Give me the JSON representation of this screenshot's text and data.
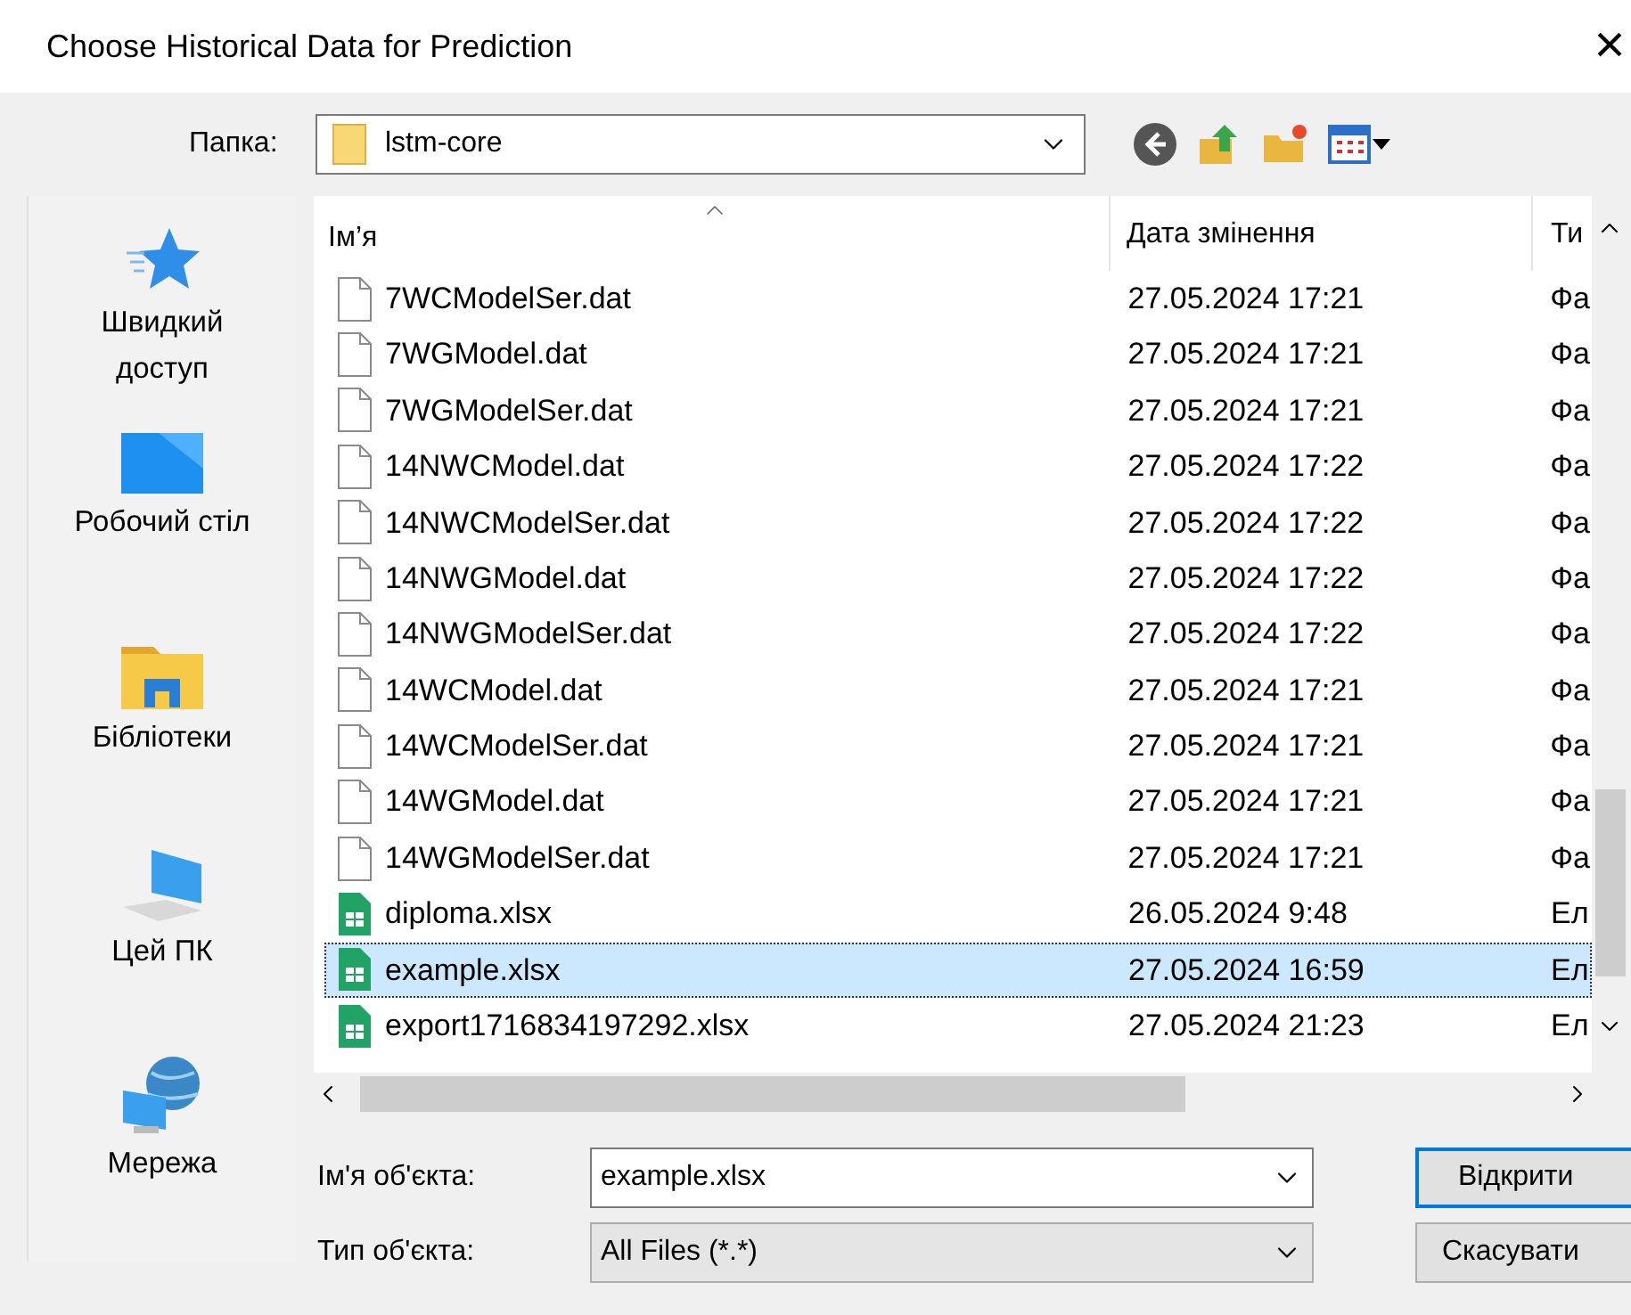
{
  "window": {
    "title": "Choose Historical Data for Prediction",
    "close": "×"
  },
  "look_in": {
    "label": "Папка:",
    "value": "lstm-core"
  },
  "places": [
    {
      "label": "Швидкий доступ"
    },
    {
      "label": "Робочий стіл"
    },
    {
      "label": "Бібліотеки"
    },
    {
      "label": "Цей ПК"
    },
    {
      "label": "Мережа"
    }
  ],
  "table": {
    "columns": [
      "Ім’я",
      "Дата змінення",
      "Ти"
    ],
    "rows": [
      {
        "kind": "dat",
        "name": "7WCModelSer.dat",
        "date": "27.05.2024 17:21",
        "type": "Фа",
        "selected": false
      },
      {
        "kind": "dat",
        "name": "7WGModel.dat",
        "date": "27.05.2024 17:21",
        "type": "Фа",
        "selected": false
      },
      {
        "kind": "dat",
        "name": "7WGModelSer.dat",
        "date": "27.05.2024 17:21",
        "type": "Фа",
        "selected": false
      },
      {
        "kind": "dat",
        "name": "14NWCModel.dat",
        "date": "27.05.2024 17:22",
        "type": "Фа",
        "selected": false
      },
      {
        "kind": "dat",
        "name": "14NWCModelSer.dat",
        "date": "27.05.2024 17:22",
        "type": "Фа",
        "selected": false
      },
      {
        "kind": "dat",
        "name": "14NWGModel.dat",
        "date": "27.05.2024 17:22",
        "type": "Фа",
        "selected": false
      },
      {
        "kind": "dat",
        "name": "14NWGModelSer.dat",
        "date": "27.05.2024 17:22",
        "type": "Фа",
        "selected": false
      },
      {
        "kind": "dat",
        "name": "14WCModel.dat",
        "date": "27.05.2024 17:21",
        "type": "Фа",
        "selected": false
      },
      {
        "kind": "dat",
        "name": "14WCModelSer.dat",
        "date": "27.05.2024 17:21",
        "type": "Фа",
        "selected": false
      },
      {
        "kind": "dat",
        "name": "14WGModel.dat",
        "date": "27.05.2024 17:21",
        "type": "Фа",
        "selected": false
      },
      {
        "kind": "dat",
        "name": "14WGModelSer.dat",
        "date": "27.05.2024 17:21",
        "type": "Фа",
        "selected": false
      },
      {
        "kind": "xlsx",
        "name": "diploma.xlsx",
        "date": "26.05.2024 9:48",
        "type": "Ел",
        "selected": false
      },
      {
        "kind": "xlsx",
        "name": "example.xlsx",
        "date": "27.05.2024 16:59",
        "type": "Ел",
        "selected": true
      },
      {
        "kind": "xlsx",
        "name": "export1716834197292.xlsx",
        "date": "27.05.2024 21:23",
        "type": "Ел",
        "selected": false
      }
    ]
  },
  "file_name": {
    "label": "Ім'я об'єкта:",
    "value": "example.xlsx"
  },
  "file_type": {
    "label": "Тип об'єкта:",
    "value": "All Files (*.*)"
  },
  "buttons": [
    {
      "label": "Відкрити",
      "default": true
    },
    {
      "label": "Скасувати",
      "default": false
    }
  ]
}
